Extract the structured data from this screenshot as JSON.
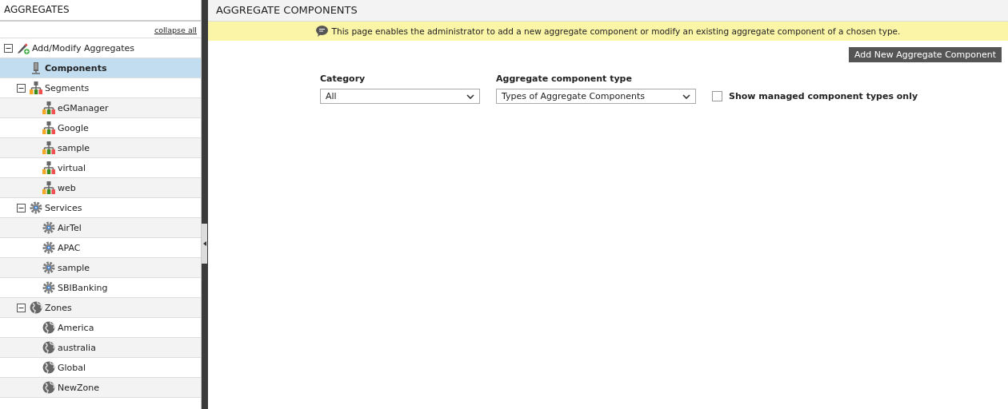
{
  "sidebar": {
    "title": "AGGREGATES",
    "collapse_link": "collapse all",
    "tree": [
      {
        "label": "Add/Modify Aggregates",
        "kind": "tool",
        "expanded": true,
        "selected": false,
        "children": [
          {
            "label": "Components",
            "kind": "server",
            "selected": true
          },
          {
            "label": "Segments",
            "kind": "segment",
            "expanded": true,
            "selected": false,
            "children": [
              {
                "label": "eGManager",
                "kind": "segment",
                "selected": false
              },
              {
                "label": "Google",
                "kind": "segment",
                "selected": false
              },
              {
                "label": "sample",
                "kind": "segment",
                "selected": false
              },
              {
                "label": "virtual",
                "kind": "segment",
                "selected": false
              },
              {
                "label": "web",
                "kind": "segment",
                "selected": false
              }
            ]
          },
          {
            "label": "Services",
            "kind": "service",
            "expanded": true,
            "selected": false,
            "children": [
              {
                "label": "AirTel",
                "kind": "service",
                "selected": false
              },
              {
                "label": "APAC",
                "kind": "service",
                "selected": false
              },
              {
                "label": "sample",
                "kind": "service",
                "selected": false
              },
              {
                "label": "SBIBanking",
                "kind": "service",
                "selected": false
              }
            ]
          },
          {
            "label": "Zones",
            "kind": "zone",
            "expanded": true,
            "selected": false,
            "children": [
              {
                "label": "America",
                "kind": "zone",
                "selected": false
              },
              {
                "label": "australia",
                "kind": "zone",
                "selected": false
              },
              {
                "label": "Global",
                "kind": "zone",
                "selected": false
              },
              {
                "label": "NewZone",
                "kind": "zone",
                "selected": false
              }
            ]
          }
        ]
      }
    ]
  },
  "main": {
    "title": "AGGREGATE COMPONENTS",
    "info": "This page enables the administrator to add a new aggregate component or modify an existing aggregate component of a chosen type.",
    "add_button": "Add New Aggregate Component",
    "category": {
      "label": "Category",
      "value": "All"
    },
    "type": {
      "label": "Aggregate component type",
      "value": "Types of Aggregate Components"
    },
    "managed_only": {
      "label": "Show managed component types only",
      "checked": false
    }
  }
}
